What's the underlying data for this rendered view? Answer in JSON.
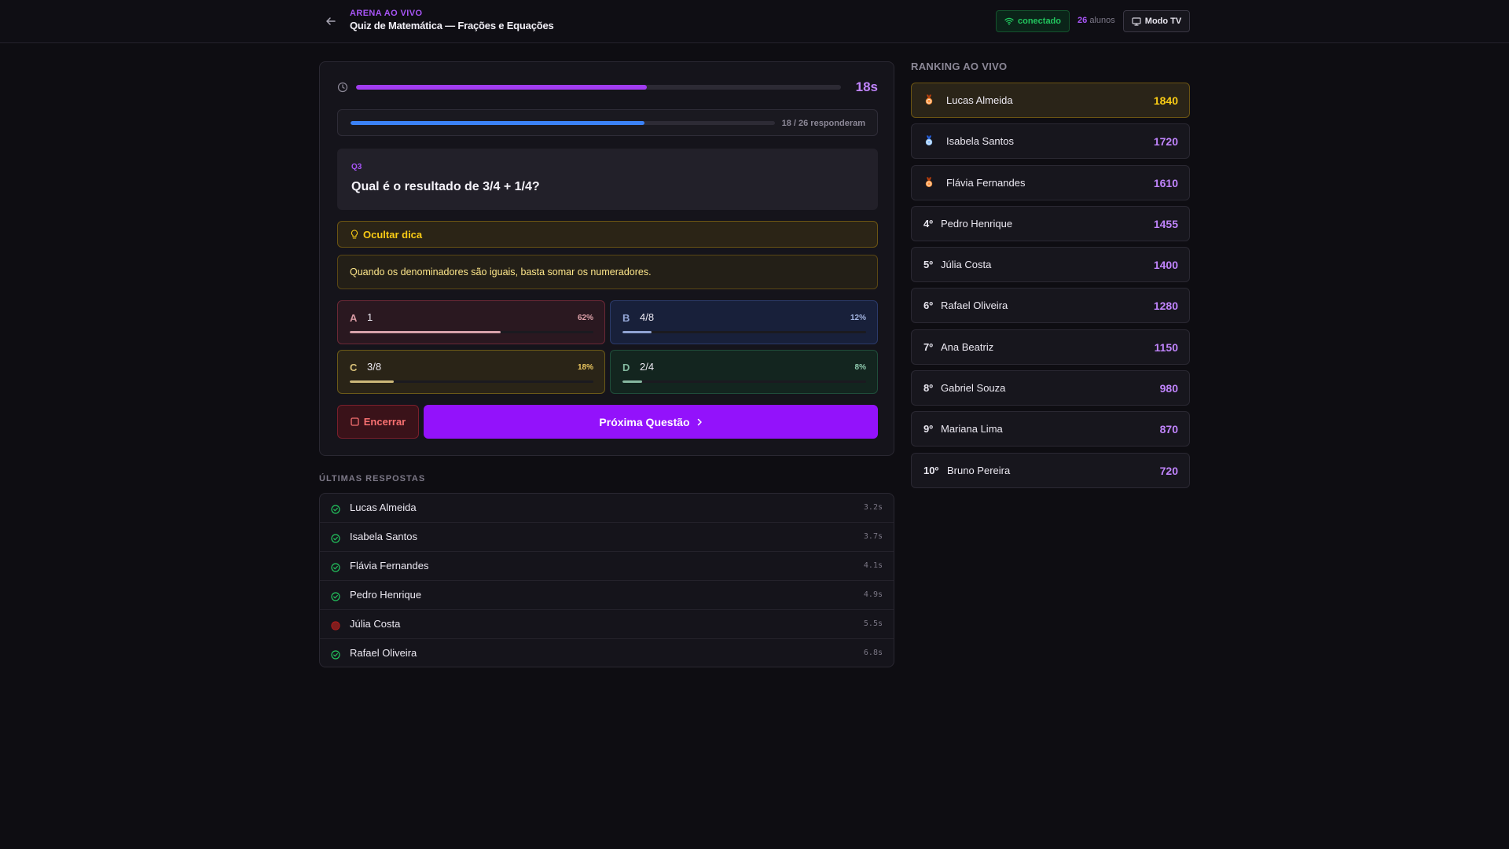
{
  "header": {
    "eyebrow": "ARENA AO VIVO",
    "title": "Quiz de Matemática — Frações e Equações",
    "connection_label": "conectado",
    "students_count": "26",
    "students_label": "alunos",
    "tv_mode_label": "Modo TV"
  },
  "timer": {
    "value_label": "18s",
    "remaining_fraction": 0.6
  },
  "responses": {
    "label": "18 / 26 responderam",
    "answered": 18,
    "total": 26
  },
  "question": {
    "number": "Q3",
    "text": "Qual é o resultado de 3/4 + 1/4?"
  },
  "hint": {
    "toggle_label": "Ocultar dica",
    "text": "Quando os denominadores são iguais, basta somar os numeradores."
  },
  "options": [
    {
      "letter": "A",
      "text": "1",
      "pct_label": "62%",
      "pct": 62
    },
    {
      "letter": "B",
      "text": "4/8",
      "pct_label": "12%",
      "pct": 12
    },
    {
      "letter": "C",
      "text": "3/8",
      "pct_label": "18%",
      "pct": 18
    },
    {
      "letter": "D",
      "text": "2/4",
      "pct_label": "8%",
      "pct": 8
    }
  ],
  "actions": {
    "end_label": "Encerrar",
    "next_label": "Próxima Questão"
  },
  "recent": {
    "title": "ÚLTIMAS RESPOSTAS",
    "rows": [
      {
        "name": "Lucas Almeida",
        "time": "3.2s",
        "status": "correct"
      },
      {
        "name": "Isabela Santos",
        "time": "3.7s",
        "status": "correct"
      },
      {
        "name": "Flávia Fernandes",
        "time": "4.1s",
        "status": "correct"
      },
      {
        "name": "Pedro Henrique",
        "time": "4.9s",
        "status": "correct"
      },
      {
        "name": "Júlia Costa",
        "time": "5.5s",
        "status": "wrong"
      },
      {
        "name": "Rafael Oliveira",
        "time": "6.8s",
        "status": "correct"
      }
    ]
  },
  "ranking": {
    "title": "RANKING AO VIVO",
    "rows": [
      {
        "pos": "",
        "medal": "gold",
        "name": "Lucas Almeida",
        "score": "1840"
      },
      {
        "pos": "",
        "medal": "silver",
        "name": "Isabela Santos",
        "score": "1720"
      },
      {
        "pos": "",
        "medal": "bronze",
        "name": "Flávia Fernandes",
        "score": "1610"
      },
      {
        "pos": "4º",
        "medal": "",
        "name": "Pedro Henrique",
        "score": "1455"
      },
      {
        "pos": "5º",
        "medal": "",
        "name": "Júlia Costa",
        "score": "1400"
      },
      {
        "pos": "6º",
        "medal": "",
        "name": "Rafael Oliveira",
        "score": "1280"
      },
      {
        "pos": "7º",
        "medal": "",
        "name": "Ana Beatriz",
        "score": "1150"
      },
      {
        "pos": "8º",
        "medal": "",
        "name": "Gabriel Souza",
        "score": "980"
      },
      {
        "pos": "9º",
        "medal": "",
        "name": "Mariana Lima",
        "score": "870"
      },
      {
        "pos": "10º",
        "medal": "",
        "name": "Bruno Pereira",
        "score": "720"
      }
    ]
  },
  "colors": {
    "accent": "#9312fb",
    "connected": "#22c55e",
    "gold": "#facc15",
    "danger": "#f87171"
  }
}
